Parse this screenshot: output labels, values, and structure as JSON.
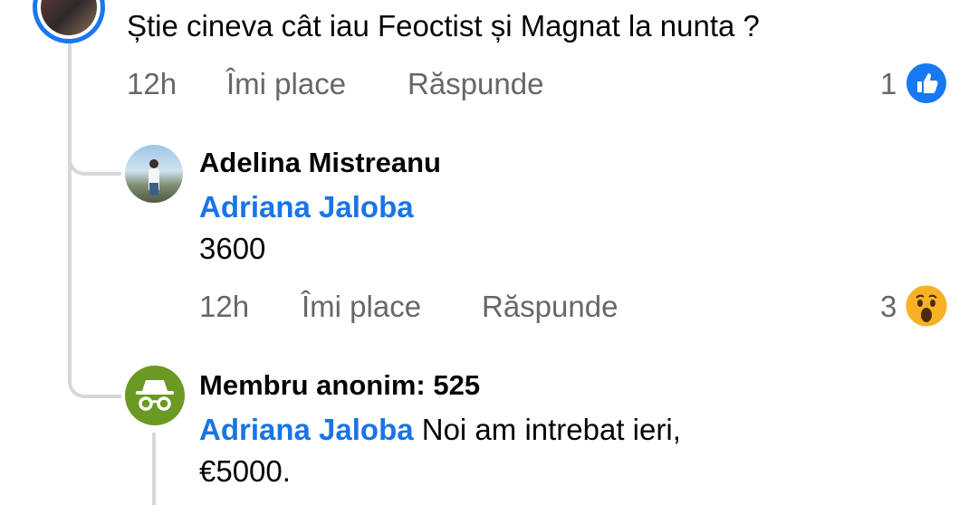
{
  "comments": [
    {
      "text": "Știe cineva cât iau Feoctist și Magnat la nunta ?",
      "time": "12h",
      "like_label": "Îmi place",
      "reply_label": "Răspunde",
      "reaction_count": "1",
      "reaction_icon": "like-icon"
    },
    {
      "author": "Adelina Mistreanu",
      "mention": "Adriana Jaloba",
      "text": "3600",
      "time": "12h",
      "like_label": "Îmi place",
      "reply_label": "Răspunde",
      "reaction_count": "3",
      "reaction_icon": "wow-icon"
    },
    {
      "author": "Membru anonim: 525",
      "mention": "Adriana Jaloba",
      "text_line1": "Noi am intrebat ieri,",
      "text_line2": "€5000.",
      "avatar_icon": "incognito-icon"
    }
  ],
  "colors": {
    "accent": "#1b74e4",
    "like_blue": "#1877f2",
    "anon_green": "#6a9a23",
    "wow_yellow": "#f7b125",
    "meta_gray": "#65676b"
  }
}
